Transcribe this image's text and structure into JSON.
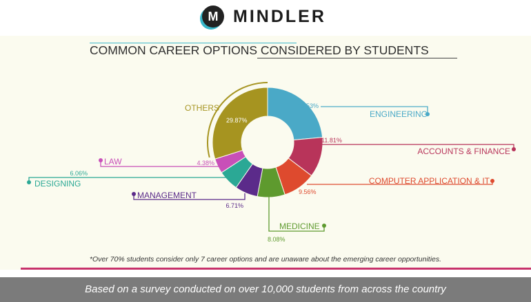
{
  "brand": {
    "logo_letter": "M",
    "name": "MINDLER"
  },
  "chart_data": {
    "type": "pie",
    "title": "COMMON CAREER OPTIONS CONSIDERED BY STUDENTS",
    "categories": [
      "ENGINEERING",
      "ACCOUNTS & FINANCE",
      "COMPUTER APPLICATION & IT",
      "MEDICINE",
      "MANAGEMENT",
      "DESIGNING",
      "LAW",
      "OTHERS"
    ],
    "values": [
      23.53,
      11.81,
      9.56,
      8.08,
      6.71,
      6.06,
      4.38,
      29.87
    ],
    "labels": [
      "23.53%",
      "11.81%",
      "9.56%",
      "8.08%",
      "6.71%",
      "6.06%",
      "4.38%",
      "29.87%"
    ],
    "colors": [
      "#4aa9c7",
      "#b8345a",
      "#de4a2e",
      "#5e9a2e",
      "#5b2b8a",
      "#2ba895",
      "#c84fb8",
      "#a69420"
    ]
  },
  "footnote": "*Over 70% students consider only 7 career options and are unaware about the emerging career opportunities.",
  "bottom_banner": "Based on a survey conducted on over 10,000 students from across the country"
}
